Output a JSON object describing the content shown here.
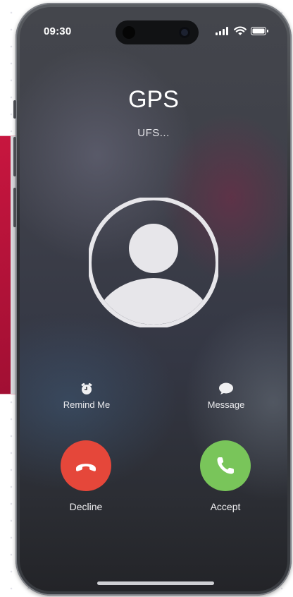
{
  "status_bar": {
    "time": "09:30",
    "signal_icon": "signal-bars-icon",
    "wifi_icon": "wifi-icon",
    "battery_icon": "battery-icon"
  },
  "caller": {
    "name": "GPS",
    "subtitle": "UFS...",
    "avatar_icon": "person-avatar-icon"
  },
  "actions": {
    "remind_me": {
      "label": "Remind Me",
      "icon": "alarm-clock-icon"
    },
    "message": {
      "label": "Message",
      "icon": "chat-bubble-icon"
    }
  },
  "call_buttons": {
    "decline": {
      "label": "Decline",
      "icon": "phone-hangup-icon",
      "color": "#e5473a"
    },
    "accept": {
      "label": "Accept",
      "icon": "phone-icon",
      "color": "#79c55a"
    }
  }
}
